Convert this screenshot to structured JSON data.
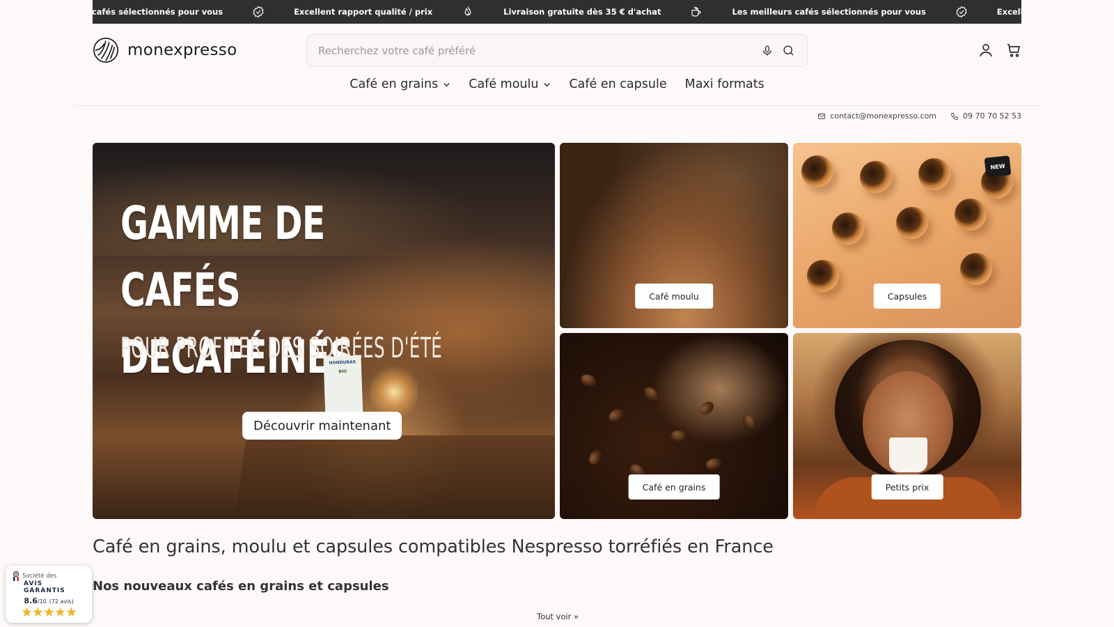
{
  "ticker": {
    "items": [
      {
        "text": "s cafés sélectionnés pour vous",
        "icon": "check-badge-icon"
      },
      {
        "text": "Excellent rapport qualité / prix",
        "icon": "flame-icon"
      },
      {
        "text": "Livraison gratuite dès 35 € d'achat",
        "icon": "coffee-cup-icon"
      },
      {
        "text": "Les meilleurs cafés sélectionnés pour vous",
        "icon": "check-badge-icon"
      },
      {
        "text": "Excellent rapport qualité / prix",
        "icon": "flame-icon"
      }
    ]
  },
  "header": {
    "logo_text": "monexpresso",
    "search_placeholder": "Recherchez votre café préféré",
    "search_value": ""
  },
  "nav": {
    "items": [
      {
        "label": "Café en grains",
        "has_dropdown": true
      },
      {
        "label": "Café moulu",
        "has_dropdown": true
      },
      {
        "label": "Café en capsule",
        "has_dropdown": false
      },
      {
        "label": "Maxi formats",
        "has_dropdown": false
      }
    ]
  },
  "contact": {
    "email": "contact@monexpresso.com",
    "phone": "09 70 70 52 53"
  },
  "hero": {
    "title_line1": "GAMME DE CAFÉS",
    "title_line2": "DECAFÉINÉS",
    "subtitle": "POUR PROFITER DES SOIRÉES D'ÉTÉ",
    "cta": "Découvrir maintenant",
    "product_label_1": "HONDURAS",
    "product_label_2": "BIO"
  },
  "tiles": [
    {
      "label": "Café moulu"
    },
    {
      "label": "Capsules",
      "badge": "NEW"
    },
    {
      "label": "Café en grains"
    },
    {
      "label": "Petits prix"
    }
  ],
  "main": {
    "heading": "Café en grains, moulu et capsules compatibles Nespresso torréfiés en France",
    "subheading": "Nos nouveaux cafés en grains et capsules",
    "see_all": "Tout voir »"
  },
  "avis": {
    "line1": "Société des",
    "line2": "AVIS GARANTIS",
    "score": "8.6",
    "scale": "/10",
    "count": "(72 avis)",
    "stars": "★★★★★"
  },
  "colors": {
    "ticker_bg": "#2f2f2f",
    "page_bg": "#fdf9f8",
    "star": "#f2b526"
  }
}
